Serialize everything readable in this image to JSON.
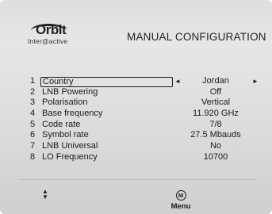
{
  "logo": {
    "brand": "Orbit",
    "sub_line": "Inter@active"
  },
  "header": {
    "title": "MANUAL CONFIGURATION"
  },
  "settings": [
    {
      "number": "1",
      "label": "Country",
      "value": "Jordan"
    },
    {
      "number": "2",
      "label": "LNB Powering",
      "value": "Off"
    },
    {
      "number": "3",
      "label": "Polarisation",
      "value": "Vertical"
    },
    {
      "number": "4",
      "label": "Base frequency",
      "value": "11.920 GHz"
    },
    {
      "number": "5",
      "label": "Code rate",
      "value": "7/8"
    },
    {
      "number": "6",
      "label": "Symbol rate",
      "value": "27.5 Mbauds"
    },
    {
      "number": "7",
      "label": "LNB Universal",
      "value": "No"
    },
    {
      "number": "8",
      "label": "LO Frequency",
      "value": "10700"
    }
  ],
  "selector": {
    "left_arrow": "◄",
    "right_arrow": "►"
  },
  "footer": {
    "nav_up": "▲",
    "nav_down": "▼",
    "menu_key_letter": "M",
    "menu_label": "Menu"
  }
}
